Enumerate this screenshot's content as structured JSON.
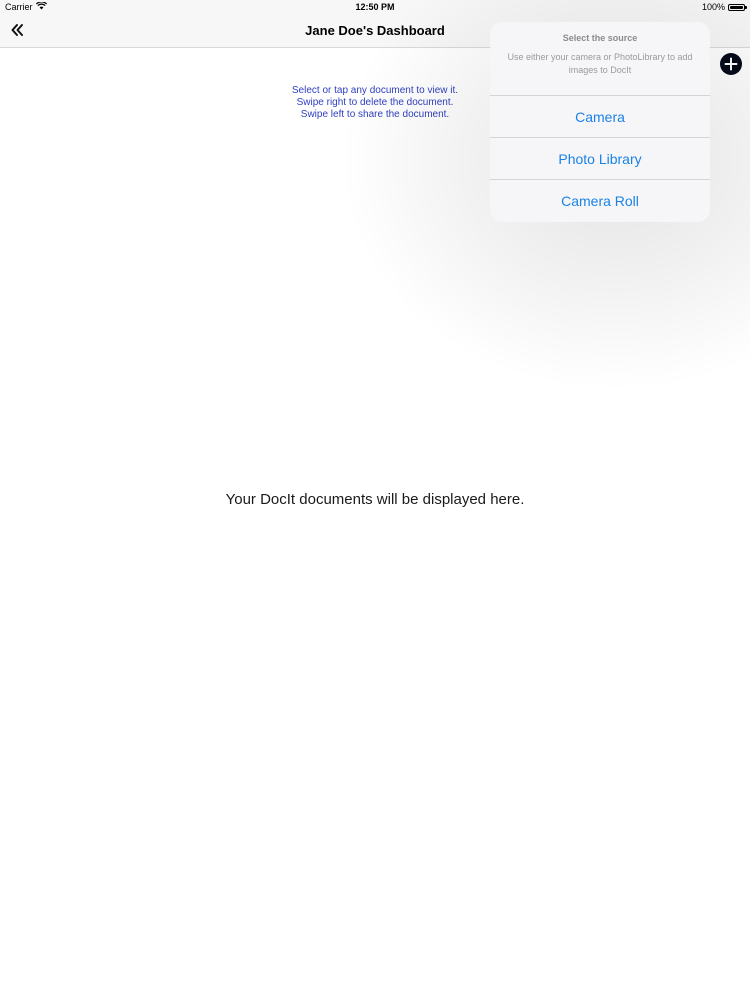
{
  "status_bar": {
    "carrier": "Carrier",
    "time": "12:50 PM",
    "battery": "100%"
  },
  "nav": {
    "title": "Jane Doe's Dashboard",
    "back_icon": "double-chevron-left-icon",
    "add_icon": "plus-circle-icon"
  },
  "instructions": [
    "Select or tap any document to view it.",
    "Swipe right to delete the document.",
    "Swipe left to share the document."
  ],
  "empty_state": {
    "message": "Your DocIt documents will be displayed here."
  },
  "popover": {
    "title": "Select the source",
    "message": "Use either your camera or PhotoLibrary to add images to DocIt",
    "actions": [
      {
        "label": "Camera"
      },
      {
        "label": "Photo Library"
      },
      {
        "label": "Camera Roll"
      }
    ]
  },
  "colors": {
    "action_blue": "#1a82e6",
    "instruction_blue": "#2f3fc0",
    "nav_background": "#f7f7f8"
  }
}
